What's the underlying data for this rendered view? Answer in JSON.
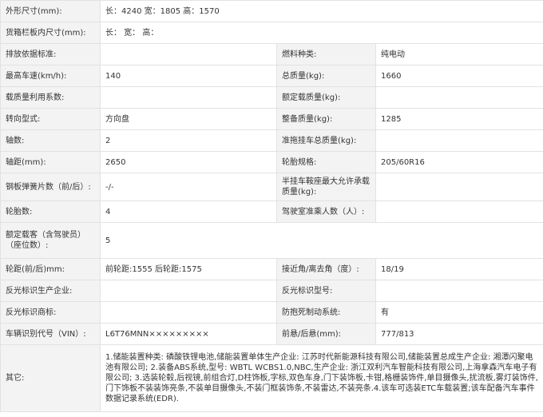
{
  "rows": [
    {
      "type": "full",
      "label": "外形尺寸(mm):",
      "value": "长：4240 宽：1805 高：1570",
      "h": 27
    },
    {
      "type": "full",
      "label": "货箱栏板内尺寸(mm):",
      "value": "长： 宽： 高：",
      "h": 27
    },
    {
      "type": "pair",
      "l1": "排放依据标准:",
      "v1": "",
      "l2": "燃料种类:",
      "v2": "纯电动",
      "h": 27
    },
    {
      "type": "pair",
      "l1": "最高车速(km/h):",
      "v1": "140",
      "l2": "总质量(kg):",
      "v2": "1660",
      "h": 27
    },
    {
      "type": "pair",
      "l1": "载质量利用系数:",
      "v1": "",
      "l2": "额定载质量(kg):",
      "v2": "",
      "h": 27
    },
    {
      "type": "pair",
      "l1": "转向型式:",
      "v1": "方向盘",
      "l2": "整备质量(kg):",
      "v2": "1285",
      "h": 27
    },
    {
      "type": "pair",
      "l1": "轴数:",
      "v1": "2",
      "l2": "准拖挂车总质量(kg):",
      "v2": "",
      "h": 27
    },
    {
      "type": "pair",
      "l1": "轴距(mm):",
      "v1": "2650",
      "l2": "轮胎规格:",
      "v2": "205/60R16",
      "h": 27
    },
    {
      "type": "pair",
      "l1": "钢板弹簧片数（前/后）:",
      "v1": "-/-",
      "l2": "半挂车鞍座最大允许承载质量(kg):",
      "v2": "",
      "h": 35
    },
    {
      "type": "pair",
      "l1": "轮胎数:",
      "v1": "4",
      "l2": "驾驶室准乘人数（人）:",
      "v2": "",
      "h": 27
    },
    {
      "type": "pair",
      "l1": "额定载客（含驾驶员）（座位数）:",
      "v1": "5",
      "l2": "",
      "v2": "",
      "span": true,
      "h": 45
    },
    {
      "type": "pair",
      "l1": "轮距(前/后)mm:",
      "v1": "前轮距:1555 后轮距:1575",
      "l2": "接近角/离去角（度）:",
      "v2": "18/19",
      "h": 27
    },
    {
      "type": "pair",
      "l1": "反光标识生产企业:",
      "v1": "",
      "l2": "反光标识型号:",
      "v2": "",
      "h": 27
    },
    {
      "type": "pair",
      "l1": "反光标识商标:",
      "v1": "",
      "l2": "防抱死制动系统:",
      "v2": "有",
      "h": 27
    },
    {
      "type": "pair",
      "l1": "车辆识别代号（VIN）:",
      "v1": "L6T76MNN×××××××××",
      "l2": "前悬/后悬(mm):",
      "v2": "777/813",
      "h": 27
    },
    {
      "type": "full",
      "label": "其它:",
      "value": "1.储能装置种类: 磷酸铁锂电池,储能装置单体生产企业: 江苏时代新能源科技有限公司,储能装置总成生产企业: 湘潭闪聚电池有限公司; 2.装备ABS系统,型号: WBTL WCBS1.0,NBC,生产企业: 浙江双利汽车智能科技有限公司,上海拿森汽车电子有限公司; 3.选装轮毂,后视镜,前组合灯,D柱饰板,字标,双色车身,门下装饰板,卡钳,格栅装饰件,单目摄像头,扰流板,雾灯装饰件,门下饰板不装装饰亮条,不装单目摄像头,不装门框装饰条,不装雷达,不装亮条.4.该车可选装ETC车载装置;该车配备汽车事件数据记录系统(EDR).",
      "h": 84
    }
  ]
}
